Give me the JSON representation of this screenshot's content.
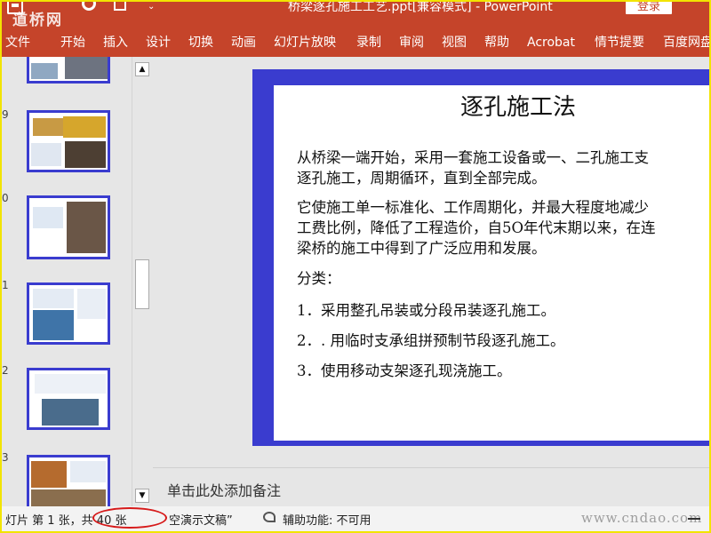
{
  "titlebar": {
    "logo": "道桥网",
    "document_title": "桥梁逐孔施工工艺.ppt[兼容模式]  -  PowerPoint",
    "login_label": "登录",
    "qat_more": "⌄"
  },
  "ribbon": {
    "tabs": [
      "文件",
      "开始",
      "插入",
      "设计",
      "切换",
      "动画",
      "幻灯片放映",
      "录制",
      "审阅",
      "视图",
      "帮助",
      "Acrobat",
      "情节提要",
      "百度网盘"
    ]
  },
  "thumbnails": {
    "numbers": [
      "9",
      "0",
      "1",
      "2",
      "3"
    ]
  },
  "slide": {
    "title": "逐孔施工法",
    "paragraphs": [
      "从桥梁一端开始，采用一套施工设备或一、二孔施工支",
      "逐孔施工，周期循环，直到全部完成。",
      "它使施工单一标准化、工作周期化，并最大程度地减少",
      "工费比例，降低了工程造价，自5O年代末期以来，在连",
      "梁桥的施工中得到了广泛应用和发展。",
      "分类：",
      "1．采用整孔吊装或分段吊装逐孔施工。",
      "2．. 用临时支承组拼预制节段逐孔施工。",
      "3．使用移动支架逐孔现浇施工。"
    ]
  },
  "notes": {
    "placeholder": "单击此处添加备注"
  },
  "statusbar": {
    "slide_info": "灯片 第 1 张，共 40 张",
    "lang": "空演示文稿”",
    "accessibility": "辅助功能: 不可用",
    "watermark": "www.cndao.com"
  },
  "colors": {
    "accent": "#c5442a",
    "slide_border": "#3a3ccf",
    "annotation_ring": "#d61a1a"
  }
}
